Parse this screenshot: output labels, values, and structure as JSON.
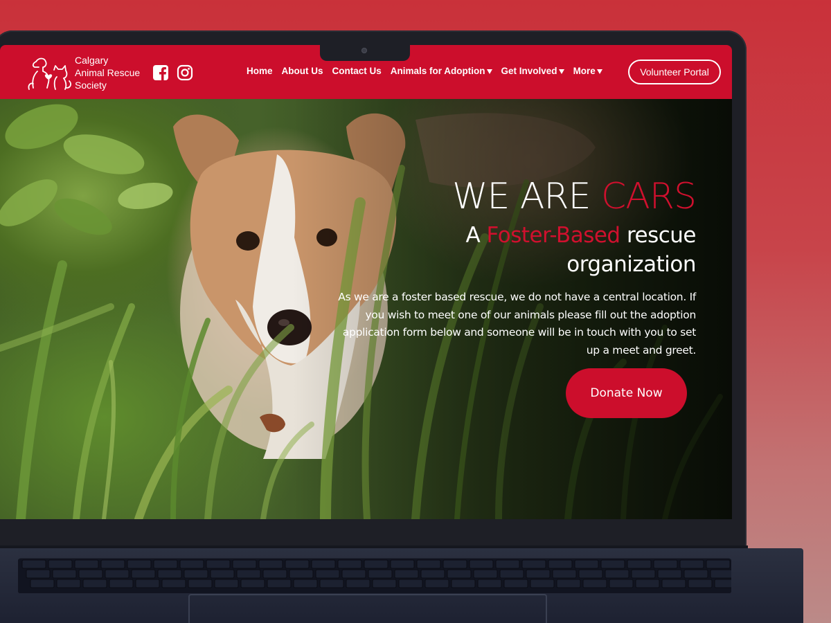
{
  "brand": {
    "name_line1": "Calgary",
    "name_line2": "Animal Rescue",
    "name_line3": "Society",
    "primary_color": "#cc0e2c",
    "logo_icon": "dog-and-cat-logo-icon"
  },
  "social": {
    "facebook_icon": "facebook-icon",
    "instagram_icon": "instagram-icon"
  },
  "nav": {
    "items": [
      {
        "label": "Home",
        "dropdown": false
      },
      {
        "label": "About Us",
        "dropdown": false
      },
      {
        "label": "Contact Us",
        "dropdown": false
      },
      {
        "label": "Animals for Adoption",
        "dropdown": true
      },
      {
        "label": "Get Involved",
        "dropdown": true
      },
      {
        "label": "More",
        "dropdown": true
      }
    ],
    "cta_label": "Volunteer Portal"
  },
  "hero": {
    "title_prefix": "WE ARE ",
    "title_accent": "CARS",
    "subtitle_prefix": "A ",
    "subtitle_accent": "Foster-Based",
    "subtitle_suffix_line1": " rescue",
    "subtitle_line2": "organization",
    "body": "As we are a foster based rescue, we do not have a central location. If you wish to meet one of our animals please fill out the adoption application form below and someone will be in touch with you to set up a meet and greet.",
    "donate_label": "Donate Now"
  }
}
